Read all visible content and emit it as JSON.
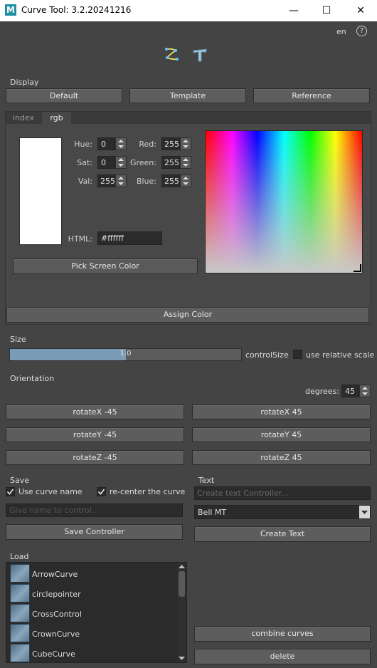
{
  "window": {
    "title": "Curve Tool: 3.2.20241216",
    "logo_letter": "M",
    "minimize_glyph": "—",
    "maximize_glyph": "☐",
    "close_glyph": "✕"
  },
  "header": {
    "language": "en",
    "help_glyph": "?"
  },
  "display": {
    "label": "Display",
    "buttons": [
      "Default",
      "Template",
      "Reference"
    ]
  },
  "color_tabs": {
    "tabs": [
      "index",
      "rgb"
    ],
    "active": "rgb"
  },
  "color": {
    "hue_label": "Hue:",
    "hue": "0",
    "sat_label": "Sat:",
    "sat": "0",
    "val_label": "Val:",
    "val": "255",
    "red_label": "Red:",
    "red": "255",
    "green_label": "Green:",
    "green": "255",
    "blue_label": "Blue:",
    "blue": "255",
    "html_label": "HTML:",
    "html": "#ffffff",
    "pick_label": "Pick Screen Color",
    "swatch": "#ffffff"
  },
  "assign_label": "Assign Color",
  "size": {
    "label": "Size",
    "value": "1.0",
    "fraction": 0.5,
    "control_label": "controlSize",
    "relative_label": "use relative scale",
    "relative_checked": false
  },
  "orientation": {
    "label": "Orientation",
    "degrees_label": "degrees:",
    "degrees": "45",
    "buttons": [
      "rotateX -45",
      "rotateX 45",
      "rotateY -45",
      "rotateY 45",
      "rotateZ -45",
      "rotateZ 45"
    ]
  },
  "save": {
    "label": "Save",
    "use_name_label": "Use curve name",
    "use_name_checked": true,
    "recenter_label": "re-center the curve",
    "recenter_checked": true,
    "name_placeholder": "Give name to control...",
    "save_label": "Save Controller"
  },
  "text": {
    "label": "Text",
    "placeholder": "Create text Controller...",
    "font": "Bell MT",
    "create_label": "Create Text"
  },
  "load": {
    "label": "Load",
    "items": [
      "ArrowCurve",
      "circlepointer",
      "CrossControl",
      "CrownCurve",
      "CubeCurve"
    ],
    "combine_label": "combine curves",
    "delete_label": "delete"
  }
}
